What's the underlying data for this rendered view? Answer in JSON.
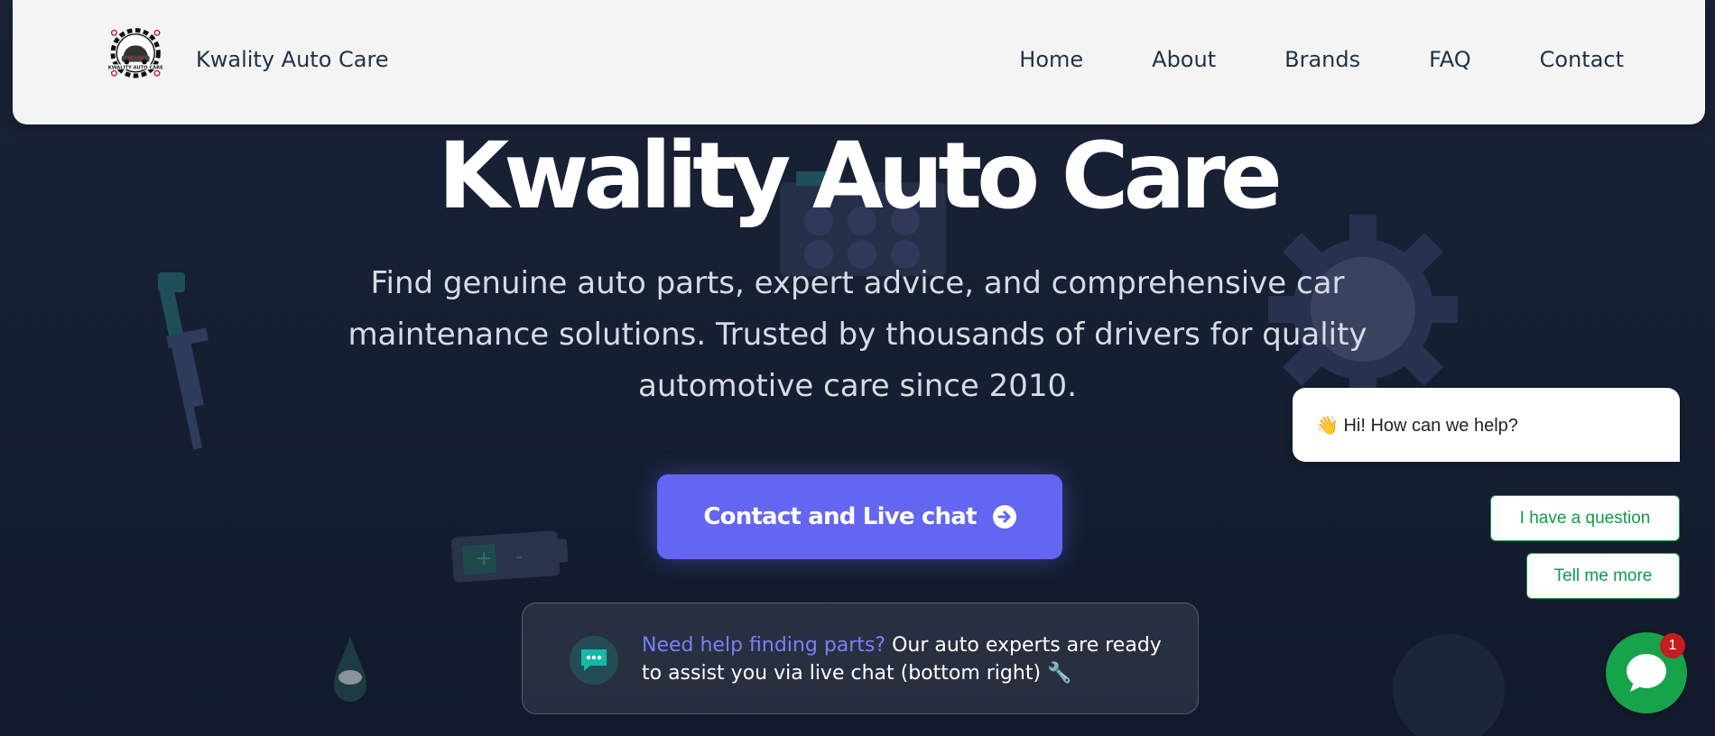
{
  "nav": {
    "brand_name": "Kwality Auto Care",
    "logo_text": "KWALITY AUTO CARE",
    "links": [
      "Home",
      "About",
      "Brands",
      "FAQ",
      "Contact"
    ]
  },
  "hero": {
    "title": "Kwality Auto Care",
    "subtitle": "Find genuine auto parts, expert advice, and comprehensive car maintenance solutions. Trusted by thousands of drivers for quality automotive care since 2010.",
    "cta_label": "Contact and Live chat",
    "help_highlight": "Need help finding parts?",
    "help_text": " Our auto experts are ready to assist you via live chat (bottom right) 🔧"
  },
  "chat": {
    "greeting": "👋  Hi! How can we help?",
    "options": [
      "I have a question",
      "Tell me more"
    ],
    "badge_count": "1"
  },
  "colors": {
    "accent": "#6366f1",
    "background": "#161e31",
    "chat_green": "#16a34a",
    "nav_bg": "#f4f4f4",
    "nav_text": "#1f3346"
  },
  "icons": [
    "logo-emblem",
    "arrow-right-circle-icon",
    "chat-bubble-icon",
    "messenger-icon"
  ]
}
